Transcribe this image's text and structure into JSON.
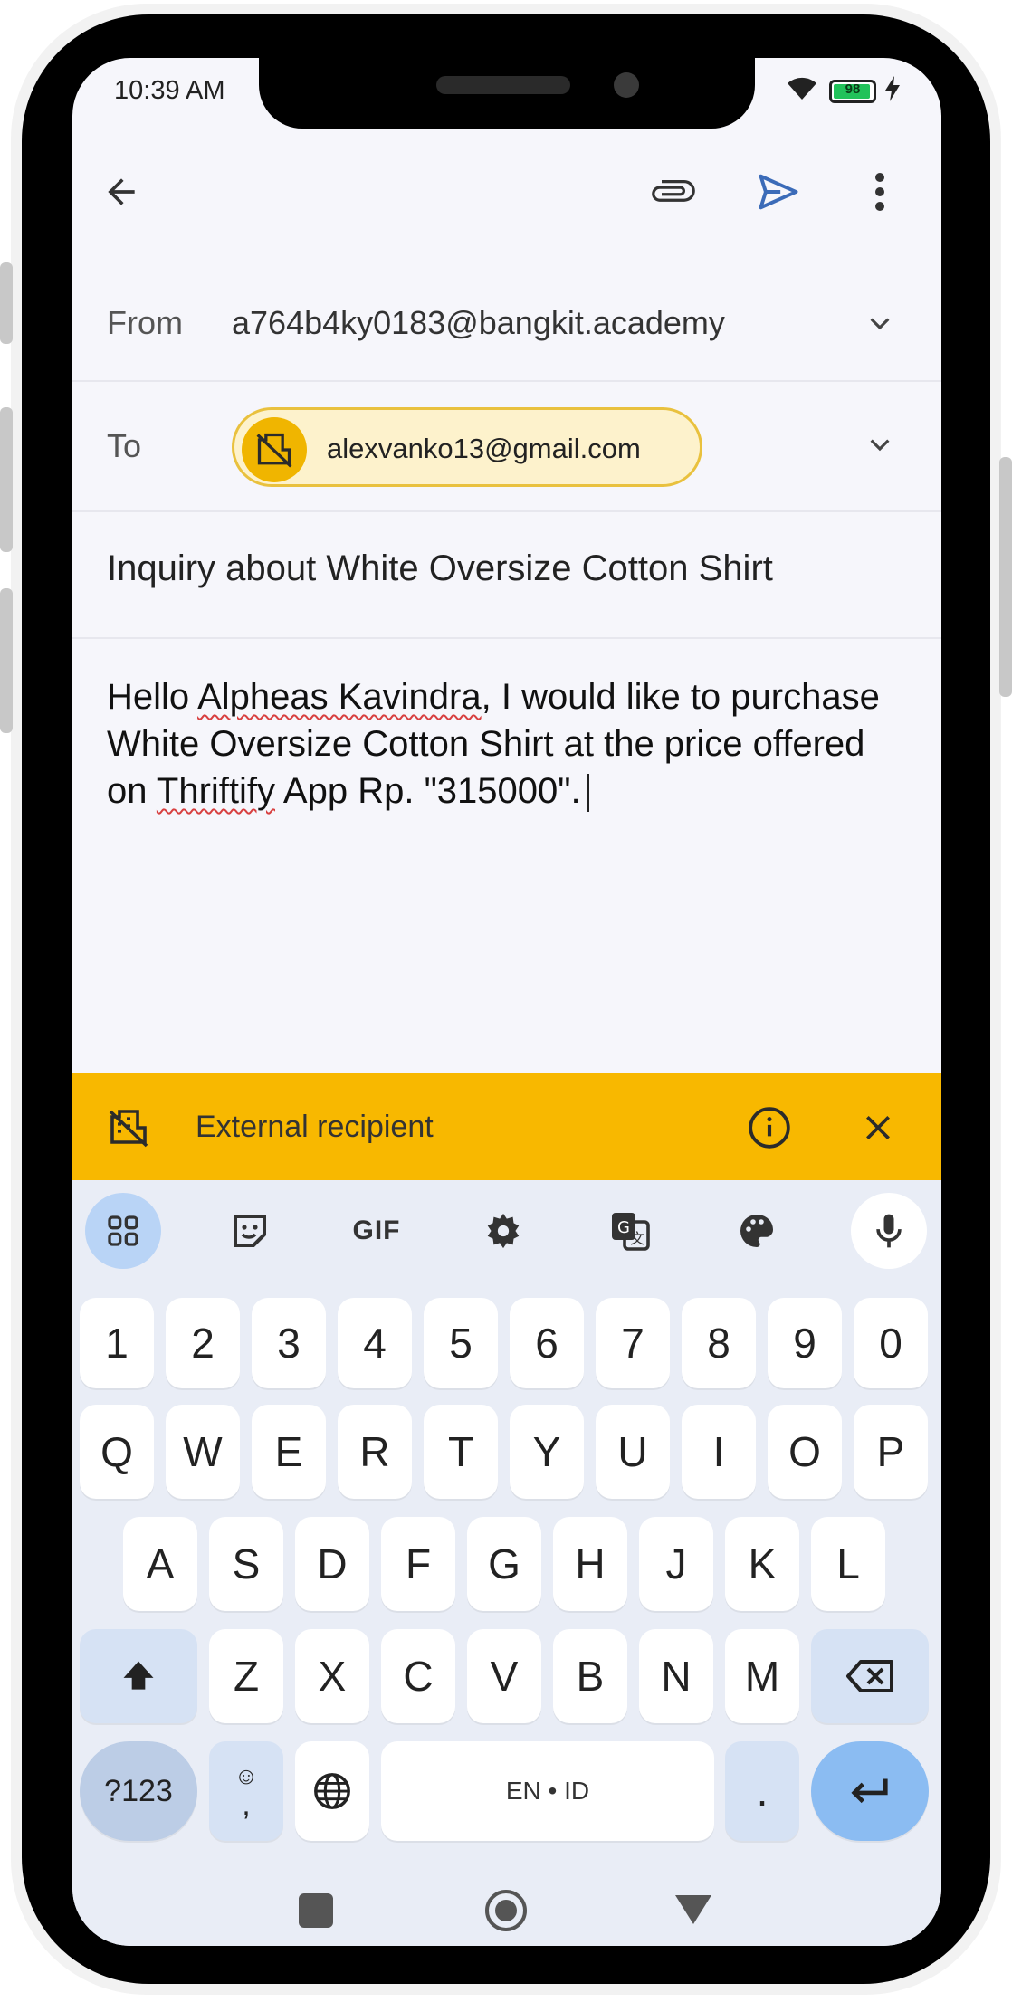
{
  "status": {
    "time": "10:39 AM",
    "battery": "98"
  },
  "compose": {
    "from_label": "From",
    "from_value": "a764b4ky0183@bangkit.academy",
    "to_label": "To",
    "to_chip": "alexvanko13@gmail.com",
    "subject": "Inquiry about White Oversize Cotton Shirt",
    "body": {
      "p1": "Hello ",
      "p2": "Alpheas Kavindra",
      "p3": ", I would like to purchase White Oversize Cotton Shirt at the price offered on ",
      "p4": "Thriftify",
      "p5": " App Rp. \"315000\"."
    }
  },
  "banner": {
    "text": "External recipient"
  },
  "keyboard": {
    "toolbar": [
      "apps",
      "sticker",
      "GIF",
      "settings",
      "translate",
      "theme",
      "voice"
    ],
    "gif_label": "GIF",
    "number_row": [
      "1",
      "2",
      "3",
      "4",
      "5",
      "6",
      "7",
      "8",
      "9",
      "0"
    ],
    "row1": [
      "Q",
      "W",
      "E",
      "R",
      "T",
      "Y",
      "U",
      "I",
      "O",
      "P"
    ],
    "row2": [
      "A",
      "S",
      "D",
      "F",
      "G",
      "H",
      "J",
      "K",
      "L"
    ],
    "row3": [
      "Z",
      "X",
      "C",
      "V",
      "B",
      "N",
      "M"
    ],
    "symbols_label": "?123",
    "comma_label": ",",
    "space_label": "EN • ID",
    "period_label": "."
  }
}
